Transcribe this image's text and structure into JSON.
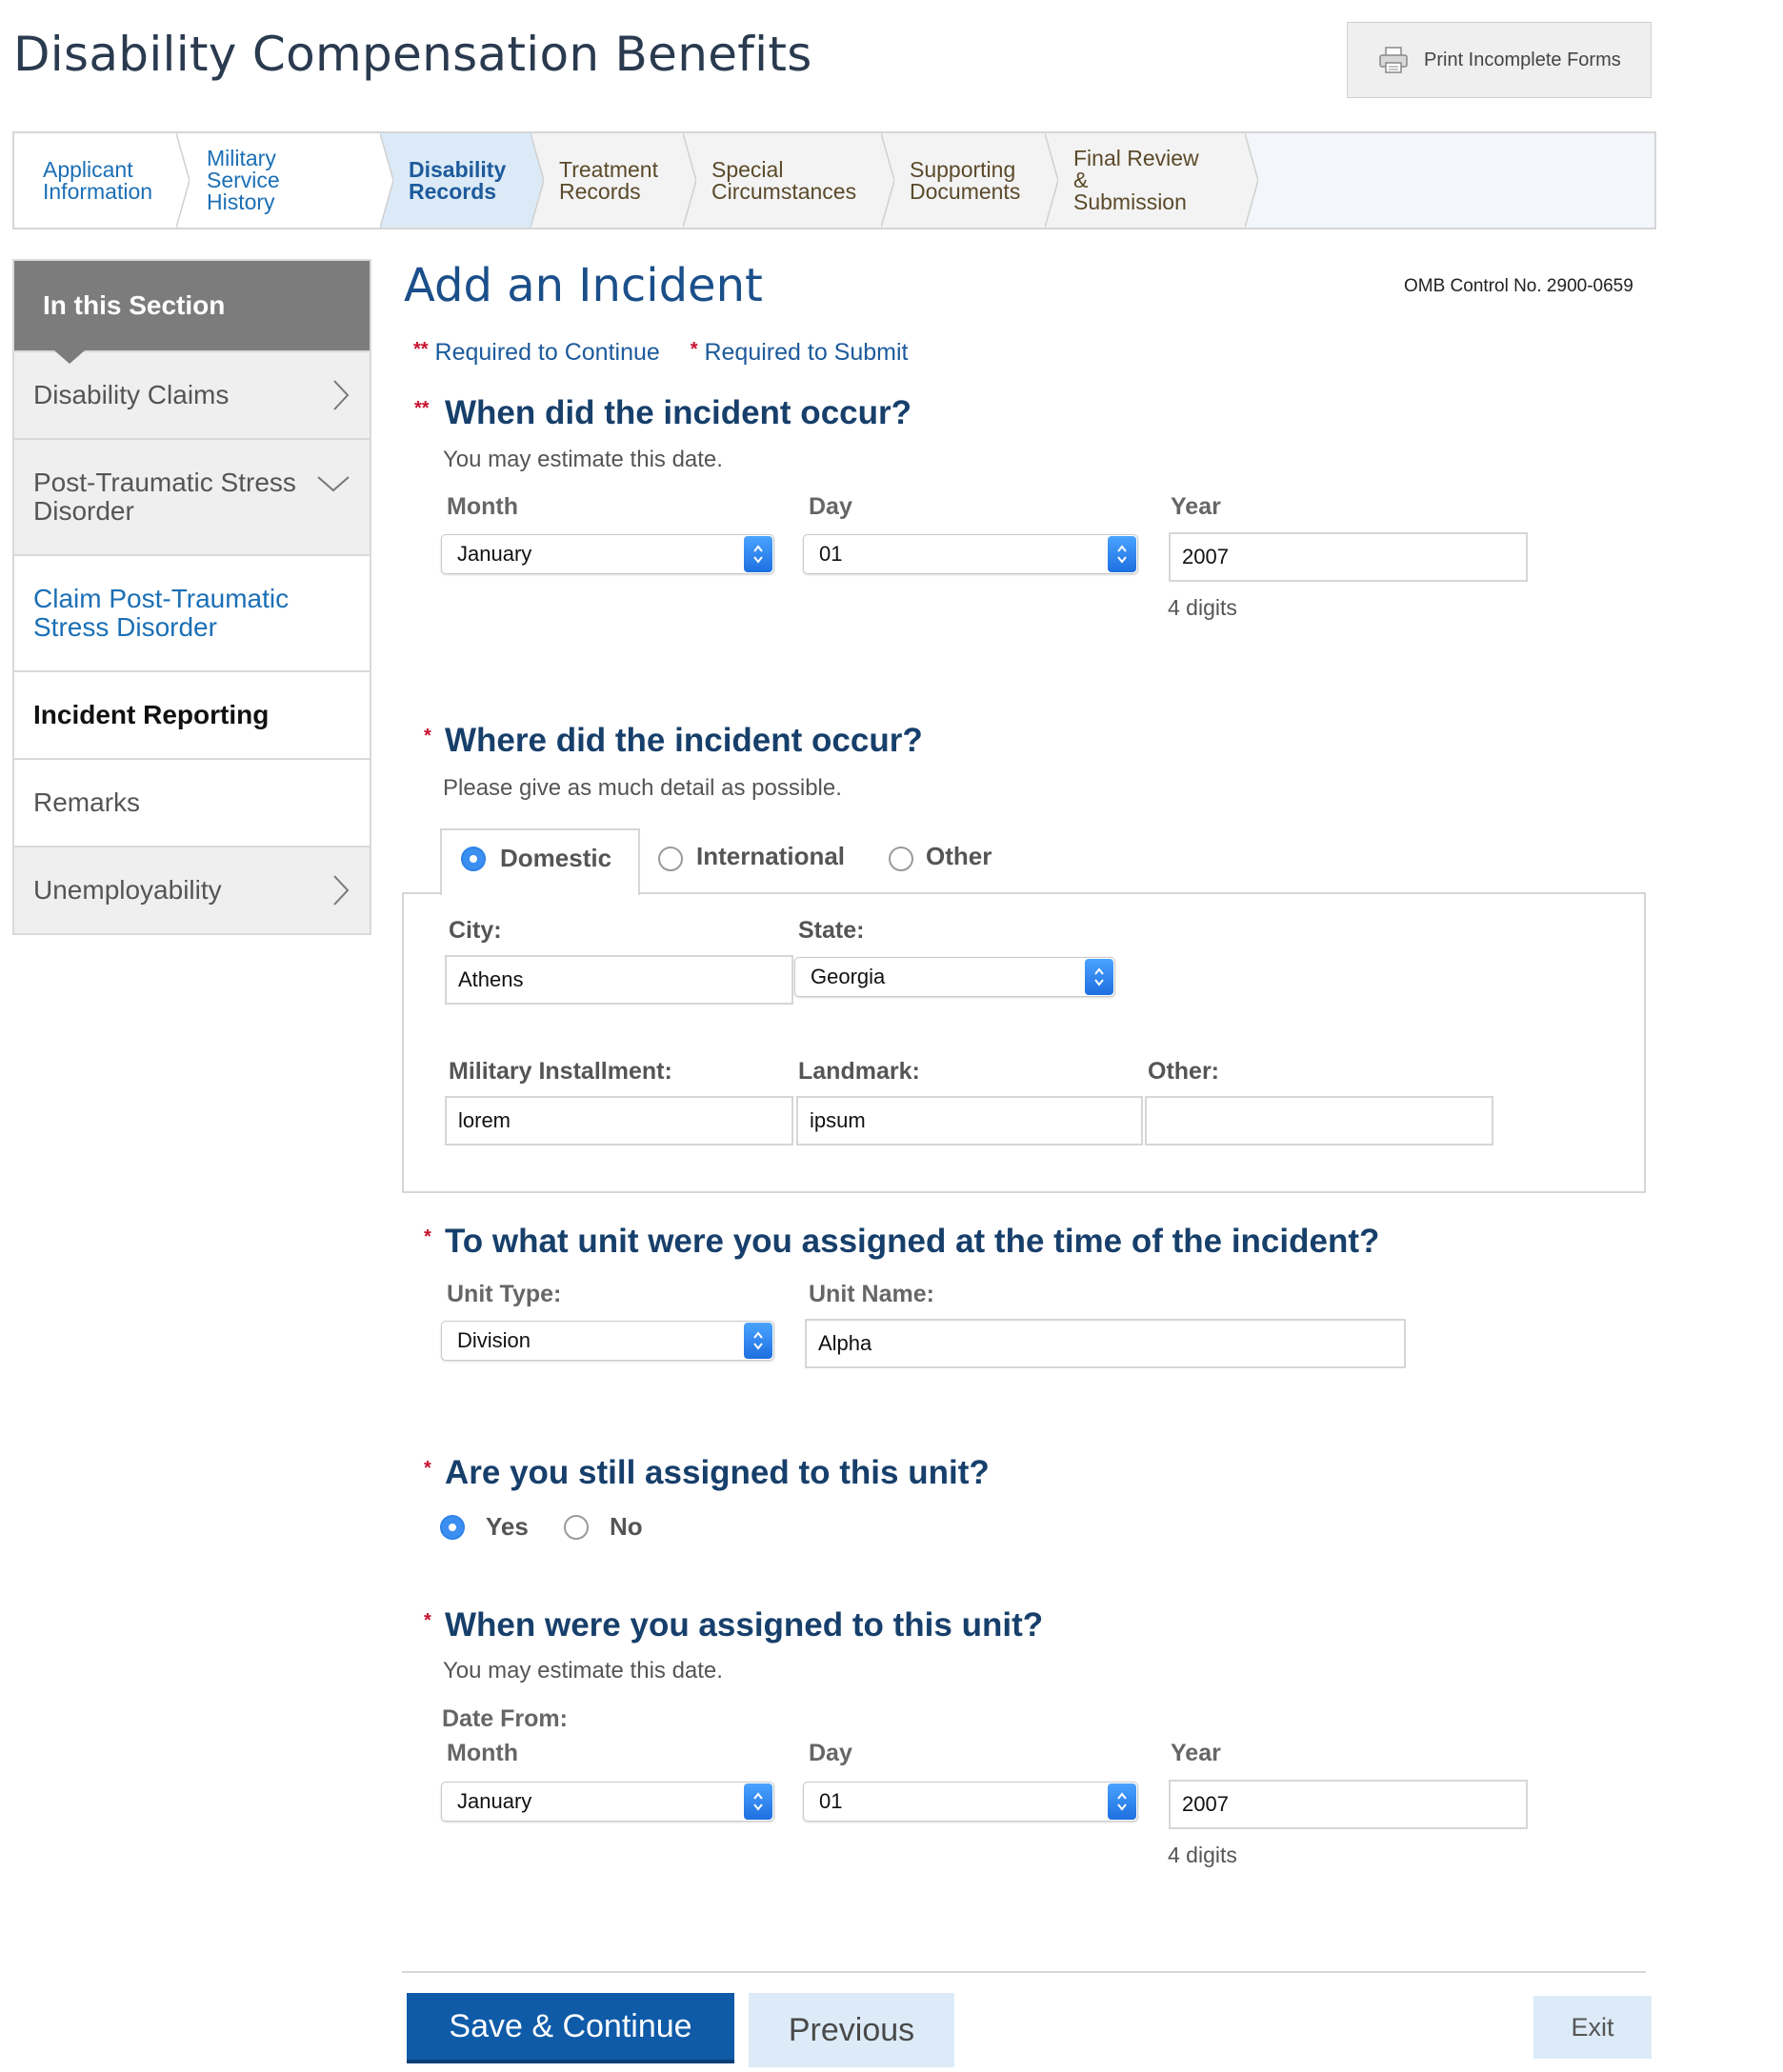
{
  "header": {
    "title": "Disability Compensation Benefits",
    "print_label": "Print Incomplete Forms"
  },
  "tabs": [
    {
      "line1": "Applicant",
      "line2": "Information",
      "state": "done"
    },
    {
      "line1": "Military Service",
      "line2": "History",
      "state": "done"
    },
    {
      "line1": "Disability",
      "line2": "Records",
      "state": "active"
    },
    {
      "line1": "Treatment",
      "line2": "Records",
      "state": "todo"
    },
    {
      "line1": "Special",
      "line2": "Circumstances",
      "state": "todo"
    },
    {
      "line1": "Supporting",
      "line2": "Documents",
      "state": "todo"
    },
    {
      "line1": "Final Review &",
      "line2": "Submission",
      "state": "todo"
    }
  ],
  "sidebar": {
    "heading": "In this Section",
    "items": [
      {
        "label": "Disability Claims",
        "icon": "chevron-right-icon"
      },
      {
        "label": "Post-Traumatic Stress Disorder",
        "icon": "chevron-down-icon"
      },
      {
        "label": "Claim Post-Traumatic Stress Disorder"
      },
      {
        "label": "Incident Reporting"
      },
      {
        "label": "Remarks"
      },
      {
        "label": "Unemployability",
        "icon": "chevron-right-icon"
      }
    ]
  },
  "main": {
    "heading": "Add an Incident",
    "omb": "OMB Control No. 2900-0659",
    "legend": {
      "continue_stars": "**",
      "continue_label": "Required to Continue",
      "submit_star": "*",
      "submit_label": "Required to Submit"
    },
    "q_when": {
      "stars": "**",
      "question": "When did the incident occur?",
      "hint": "You may estimate this date.",
      "month_label": "Month",
      "month_value": "January",
      "day_label": "Day",
      "day_value": "01",
      "year_label": "Year",
      "year_value": "2007",
      "year_hint": "4 digits"
    },
    "q_where": {
      "star": "*",
      "question": "Where did the incident occur?",
      "hint": "Please give as much detail as possible.",
      "options": [
        "Domestic",
        "International",
        "Other"
      ],
      "selected": "Domestic",
      "city_label": "City:",
      "city_value": "Athens",
      "state_label": "State:",
      "state_value": "Georgia",
      "installment_label": "Military Installment:",
      "installment_value": "lorem",
      "landmark_label": "Landmark:",
      "landmark_value": "ipsum",
      "other_label": "Other:",
      "other_value": ""
    },
    "q_unit": {
      "star": "*",
      "question": "To what unit were you assigned at the time of the incident?",
      "type_label": "Unit Type:",
      "type_value": "Division",
      "name_label": "Unit Name:",
      "name_value": "Alpha"
    },
    "q_still": {
      "star": "*",
      "question": "Are you still assigned to this unit?",
      "yes": "Yes",
      "no": "No",
      "selected": "Yes"
    },
    "q_assigned": {
      "star": "*",
      "question": "When were you assigned to this unit?",
      "hint": "You may estimate this date.",
      "date_from": "Date From:",
      "month_label": "Month",
      "month_value": "January",
      "day_label": "Day",
      "day_value": "01",
      "year_label": "Year",
      "year_value": "2007",
      "year_hint": "4 digits"
    }
  },
  "footer": {
    "save": "Save & Continue",
    "previous": "Previous",
    "exit": "Exit"
  },
  "colors": {
    "primary": "#0f5ba8",
    "heading": "#173f6b",
    "link": "#1b6fb5",
    "required": "#c8102e",
    "active_tab": "#dbeaf6"
  }
}
